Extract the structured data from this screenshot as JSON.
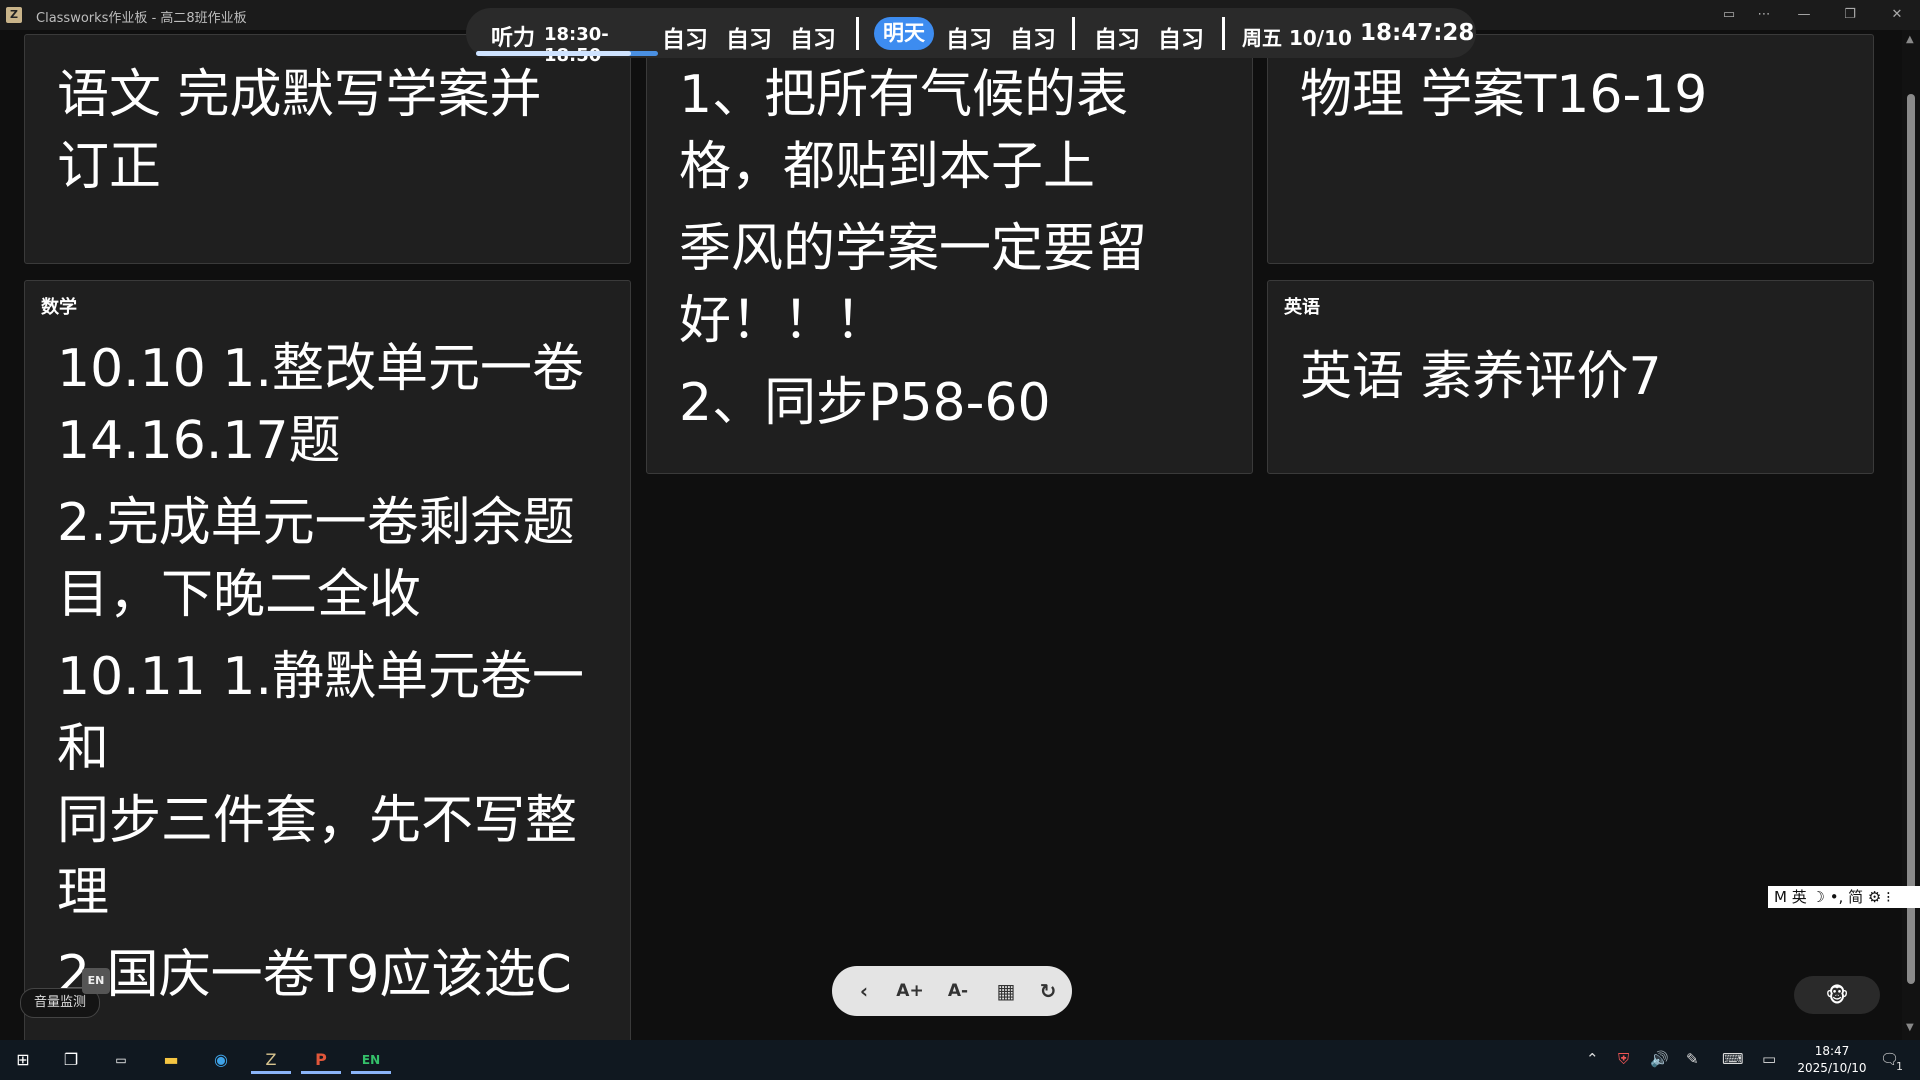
{
  "window": {
    "title": "Classworks作业板 - 高二8班作业板",
    "app_icon": "classworks-icon"
  },
  "schedule": {
    "current": {
      "label": "听力",
      "time": "18:30-18:50",
      "progress": 0.85
    },
    "today_items": [
      "自习",
      "自习",
      "自习"
    ],
    "tomorrow_label": "明天",
    "tomorrow_items_a": [
      "自习",
      "自习"
    ],
    "tomorrow_items_b": [
      "自习",
      "自习"
    ],
    "date": "周五 10/10",
    "clock": "18:47:28",
    "progress_color": "#4a90e2",
    "badge_color": "#3d8cf0"
  },
  "cards": {
    "chinese": {
      "lines": [
        "语文 完成默写学案并",
        "订正"
      ]
    },
    "geography": {
      "paragraphs": [
        [
          "1、把所有气候的表",
          "格，都贴到本子上"
        ],
        [
          "季风的学案一定要留",
          "好！！！"
        ],
        [
          "2、同步P58-60"
        ]
      ]
    },
    "physics": {
      "lines": [
        "物理 学案T16-19"
      ]
    },
    "math": {
      "title": "数学",
      "paragraphs": [
        [
          "10.10 1.整改单元一卷",
          "14.16.17题"
        ],
        [
          "2.完成单元一卷剩余题",
          "目，下晚二全收"
        ],
        [
          "10.11 1.静默单元卷一和",
          "同步三件套，先不写整",
          "理"
        ],
        [
          "2.国庆一卷T9应该选C"
        ]
      ]
    },
    "english": {
      "title": "英语",
      "lines": [
        "英语 素养评价7"
      ]
    }
  },
  "toolbar": {
    "icons": [
      "chevron-left-icon",
      "font-increase-icon",
      "font-decrease-icon",
      "calendar-icon",
      "refresh-icon"
    ]
  },
  "volume_monitor": {
    "label": "音量监测",
    "badge": "EN"
  },
  "ime": {
    "text": "M 英 ☽ •, 简 ⚙ ⁝"
  },
  "taskbar": {
    "time": "18:47",
    "date": "2025/10/10",
    "notifications": "1"
  }
}
